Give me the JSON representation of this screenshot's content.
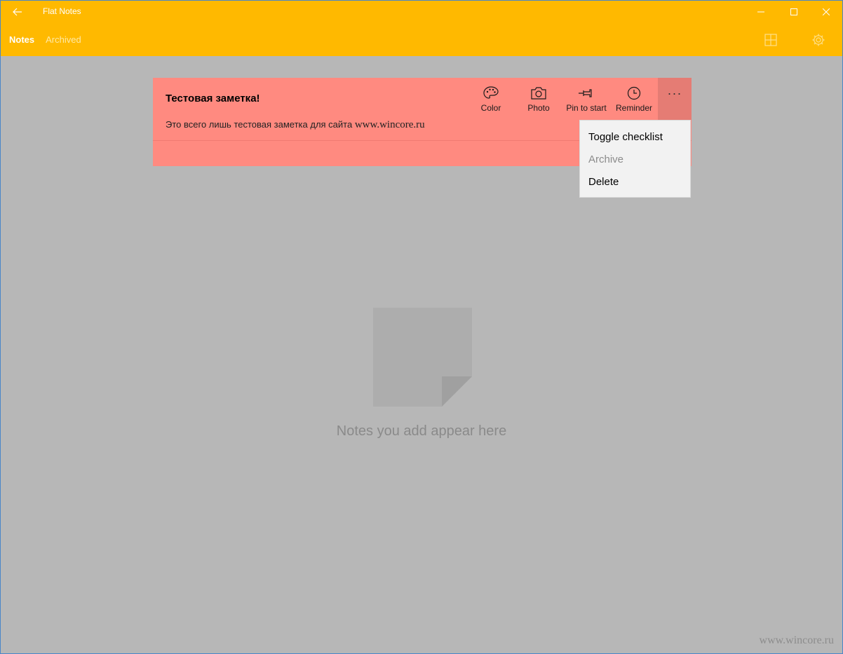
{
  "app": {
    "title": "Flat Notes"
  },
  "tabs": [
    {
      "label": "Notes",
      "active": true
    },
    {
      "label": "Archived",
      "active": false
    }
  ],
  "header_icons": [
    "grid-view-icon",
    "settings-gear-icon"
  ],
  "note": {
    "title": "Тестовая заметка!",
    "body_text": "Это всего лишь тестовая заметка для сайта ",
    "body_link": "www.wincore.ru",
    "color": "#ff8a80",
    "actions": [
      {
        "label": "Color",
        "icon": "palette-icon"
      },
      {
        "label": "Photo",
        "icon": "camera-icon"
      },
      {
        "label": "Pin to start",
        "icon": "pin-icon"
      },
      {
        "label": "Reminder",
        "icon": "clock-icon"
      }
    ],
    "more_label": "···"
  },
  "context_menu": {
    "items": [
      {
        "label": "Toggle checklist",
        "enabled": true
      },
      {
        "label": "Archive",
        "enabled": false
      },
      {
        "label": "Delete",
        "enabled": true
      }
    ]
  },
  "empty_state": {
    "text": "Notes you add appear here"
  },
  "watermark": "www.wincore.ru",
  "colors": {
    "accent": "#ffb900",
    "background": "#b7b7b7",
    "note": "#ff8a80"
  }
}
